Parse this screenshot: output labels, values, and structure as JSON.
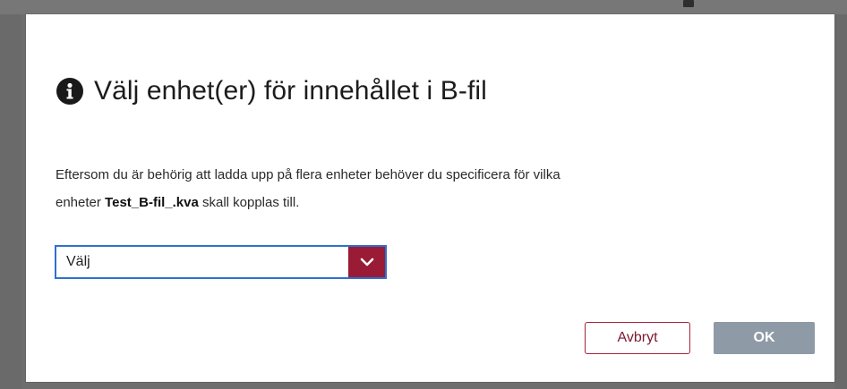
{
  "dialog": {
    "title": "Välj enhet(er) för innehållet i B-fil",
    "body_line1": "Eftersom du är behörig att ladda upp på flera enheter behöver du specificera för vilka",
    "body_line2_prefix": "enheter ",
    "filename": "Test_B-fil_.kva",
    "body_line2_suffix": " skall kopplas till.",
    "select": {
      "value": "Välj"
    },
    "buttons": {
      "cancel_label": "Avbryt",
      "ok_label": "OK"
    }
  },
  "icons": {
    "title_icon": "info-circle-icon",
    "select_icon": "chevron-down-icon"
  },
  "colors": {
    "accent": "#9a1b35",
    "select_border": "#2f6fd0",
    "ok_button_disabled": "#8e9aa6"
  }
}
